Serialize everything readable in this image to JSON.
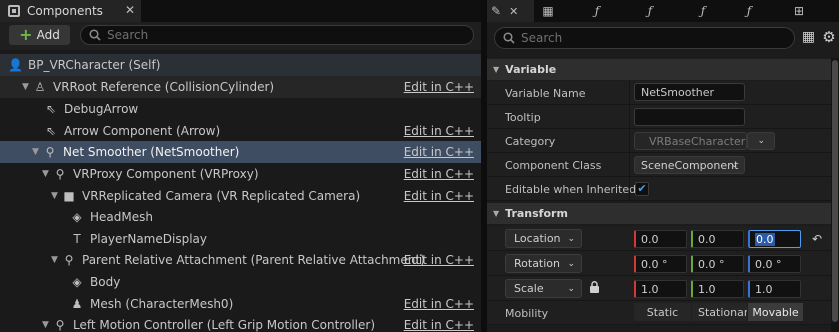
{
  "components_panel": {
    "tab_title": "Components",
    "add_label": "Add",
    "search_placeholder": "Search",
    "edit_link": "Edit in C++",
    "tree": [
      {
        "label": "BP_VRCharacter (Self)",
        "icon": "person-icon"
      },
      {
        "label": "VRRoot Reference (CollisionCylinder)",
        "icon": "root-actor-icon",
        "edit": true
      },
      {
        "label": "DebugArrow",
        "icon": "arrow-icon"
      },
      {
        "label": "Arrow Component (Arrow)",
        "icon": "arrow-icon",
        "edit": true
      },
      {
        "label": "Net Smoother (NetSmoother)",
        "icon": "scene-component-icon",
        "edit": true,
        "selected": true
      },
      {
        "label": "VRProxy Component (VRProxy)",
        "icon": "scene-component-icon",
        "edit": true
      },
      {
        "label": "VRReplicated Camera (VR Replicated Camera)",
        "icon": "camera-icon",
        "edit": true
      },
      {
        "label": "HeadMesh",
        "icon": "cube-icon"
      },
      {
        "label": "PlayerNameDisplay",
        "icon": "text-render-icon"
      },
      {
        "label": "Parent Relative Attachment (Parent Relative Attachment)",
        "icon": "scene-component-icon",
        "edit": true
      },
      {
        "label": "Body",
        "icon": "cube-icon"
      },
      {
        "label": "Mesh (CharacterMesh0)",
        "icon": "skeletal-mesh-icon",
        "edit": true
      },
      {
        "label": "Left Motion Controller (Left Grip Motion Controller)",
        "icon": "scene-component-icon",
        "edit": true
      }
    ]
  },
  "details_panel": {
    "search_placeholder": "Search",
    "variable_section": "Variable",
    "transform_section": "Transform",
    "variable": {
      "name_label": "Variable Name",
      "name_value": "NetSmoother",
      "tooltip_label": "Tooltip",
      "tooltip_value": "",
      "category_label": "Category",
      "category_value": "VRBaseCharacter",
      "component_class_label": "Component Class",
      "component_class_value": "SceneComponent",
      "editable_label": "Editable when Inherited",
      "editable_checked": true
    },
    "transform": {
      "location_label": "Location",
      "location": [
        "0.0",
        "0.0",
        "0.0"
      ],
      "rotation_label": "Rotation",
      "rotation": [
        "0.0 °",
        "0.0 °",
        "0.0 °"
      ],
      "scale_label": "Scale",
      "scale": [
        "1.0",
        "1.0",
        "1.0"
      ],
      "mobility_label": "Mobility",
      "mobility_options": [
        "Static",
        "Stationar",
        "Movable"
      ],
      "mobility_selected": "Movable"
    }
  }
}
